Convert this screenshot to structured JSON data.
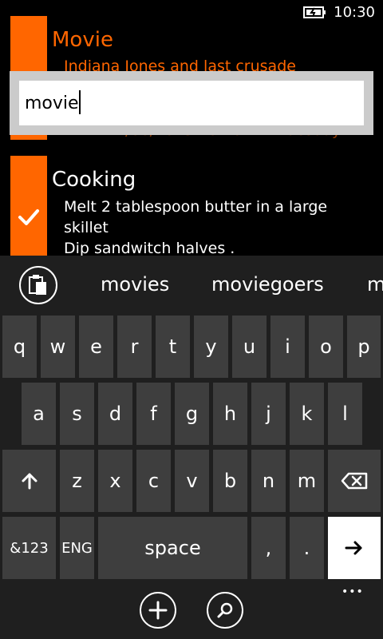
{
  "status": {
    "time": "10:30"
  },
  "notes": [
    {
      "title": "Movie",
      "subtitle": "Indiana Jones and last crusade",
      "date": "11/06/2013 10:20:21",
      "day": "Tuesday"
    },
    {
      "title": "Cooking",
      "lines": [
        "Melt 2 tablespoon butter in a large",
        "skillet",
        "Dip sandwitch halves ."
      ]
    }
  ],
  "search": {
    "value": "movie"
  },
  "keyboard": {
    "suggestions": [
      "movies",
      "moviegoers",
      "m"
    ],
    "row1": [
      "q",
      "w",
      "e",
      "r",
      "t",
      "y",
      "u",
      "i",
      "o",
      "p"
    ],
    "row2": [
      "a",
      "s",
      "d",
      "f",
      "g",
      "h",
      "j",
      "k",
      "l"
    ],
    "row3": [
      "z",
      "x",
      "c",
      "v",
      "b",
      "n",
      "m"
    ],
    "symbols_label": "&123",
    "lang_label": "ENG",
    "space_label": "space",
    "comma": ",",
    "period": "."
  },
  "appbar": {
    "more": "•••"
  }
}
